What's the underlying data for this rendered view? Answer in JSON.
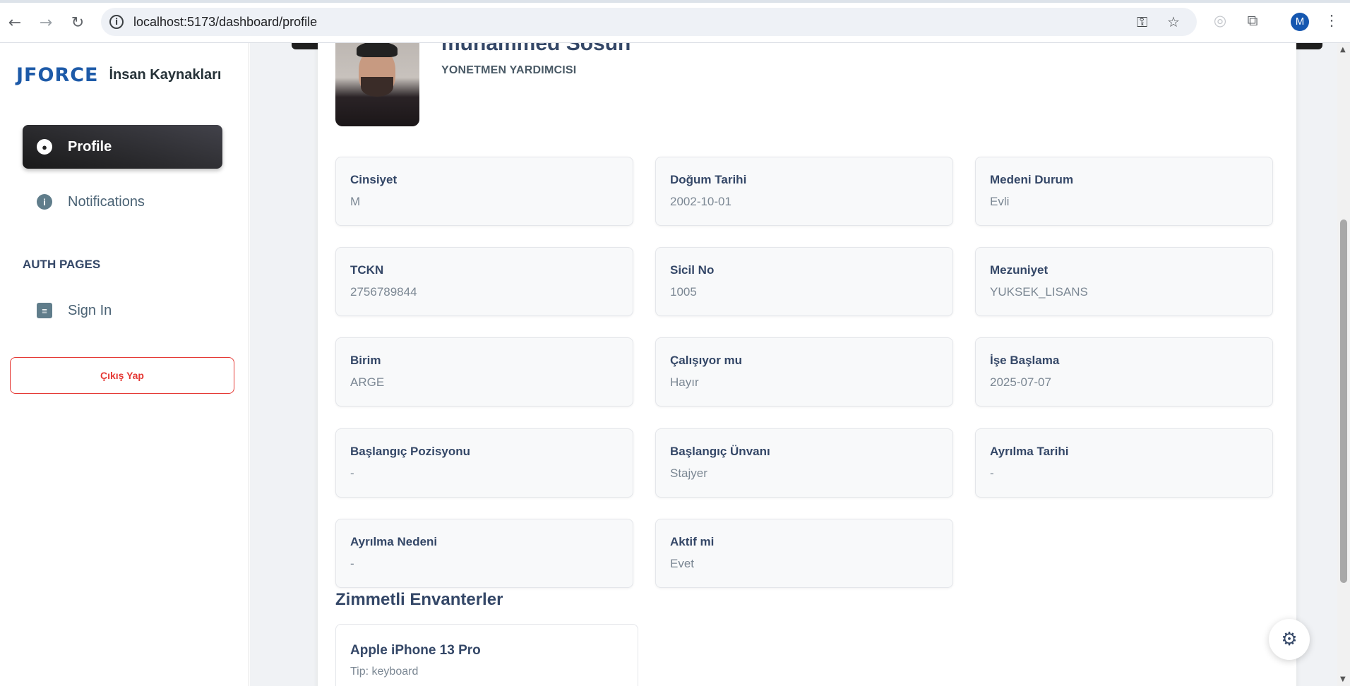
{
  "browser": {
    "url": "localhost:5173/dashboard/profile",
    "back_icon": "←",
    "forward_icon": "→",
    "reload_icon": "↻",
    "info_icon": "i",
    "key_icon": "⚿",
    "star_icon": "☆",
    "extension_icon": "⧉",
    "menu_icon": "⋮",
    "profile_initial": "M"
  },
  "sidebar": {
    "logo_text": "JFORCE",
    "brand_name": "İnsan Kaynakları",
    "items": [
      {
        "label": "Profile",
        "icon": "user-circle-icon",
        "active": true
      },
      {
        "label": "Notifications",
        "icon": "info-icon",
        "active": false
      }
    ],
    "section_label": "AUTH PAGES",
    "auth_items": [
      {
        "label": "Sign In",
        "icon": "server-icon"
      }
    ],
    "logout_label": "Çıkış Yap"
  },
  "profile": {
    "name": "muhammed Sosun",
    "title": "YONETMEN YARDIMCISI",
    "fields": [
      {
        "key": "Cinsiyet",
        "value": "M"
      },
      {
        "key": "Doğum Tarihi",
        "value": "2002-10-01"
      },
      {
        "key": "Medeni Durum",
        "value": "Evli"
      },
      {
        "key": "TCKN",
        "value": "2756789844"
      },
      {
        "key": "Sicil No",
        "value": "1005"
      },
      {
        "key": "Mezuniyet",
        "value": "YUKSEK_LISANS"
      },
      {
        "key": "Birim",
        "value": "ARGE"
      },
      {
        "key": "Çalışıyor mu",
        "value": "Hayır"
      },
      {
        "key": "İşe Başlama",
        "value": "2025-07-07"
      },
      {
        "key": "Başlangıç Pozisyonu",
        "value": "-"
      },
      {
        "key": "Başlangıç Ünvanı",
        "value": "Stajyer"
      },
      {
        "key": "Ayrılma Tarihi",
        "value": "-"
      },
      {
        "key": "Ayrılma Nedeni",
        "value": "-"
      },
      {
        "key": "Aktif mi",
        "value": "Evet"
      }
    ]
  },
  "inventory": {
    "section_title": "Zimmetli Envanterler",
    "items": [
      {
        "name": "Apple iPhone 13 Pro",
        "type": "Tip: keyboard"
      }
    ]
  },
  "colors": {
    "accent": "#344767",
    "logout": "#e53935",
    "brand": "#1d5aa8"
  }
}
